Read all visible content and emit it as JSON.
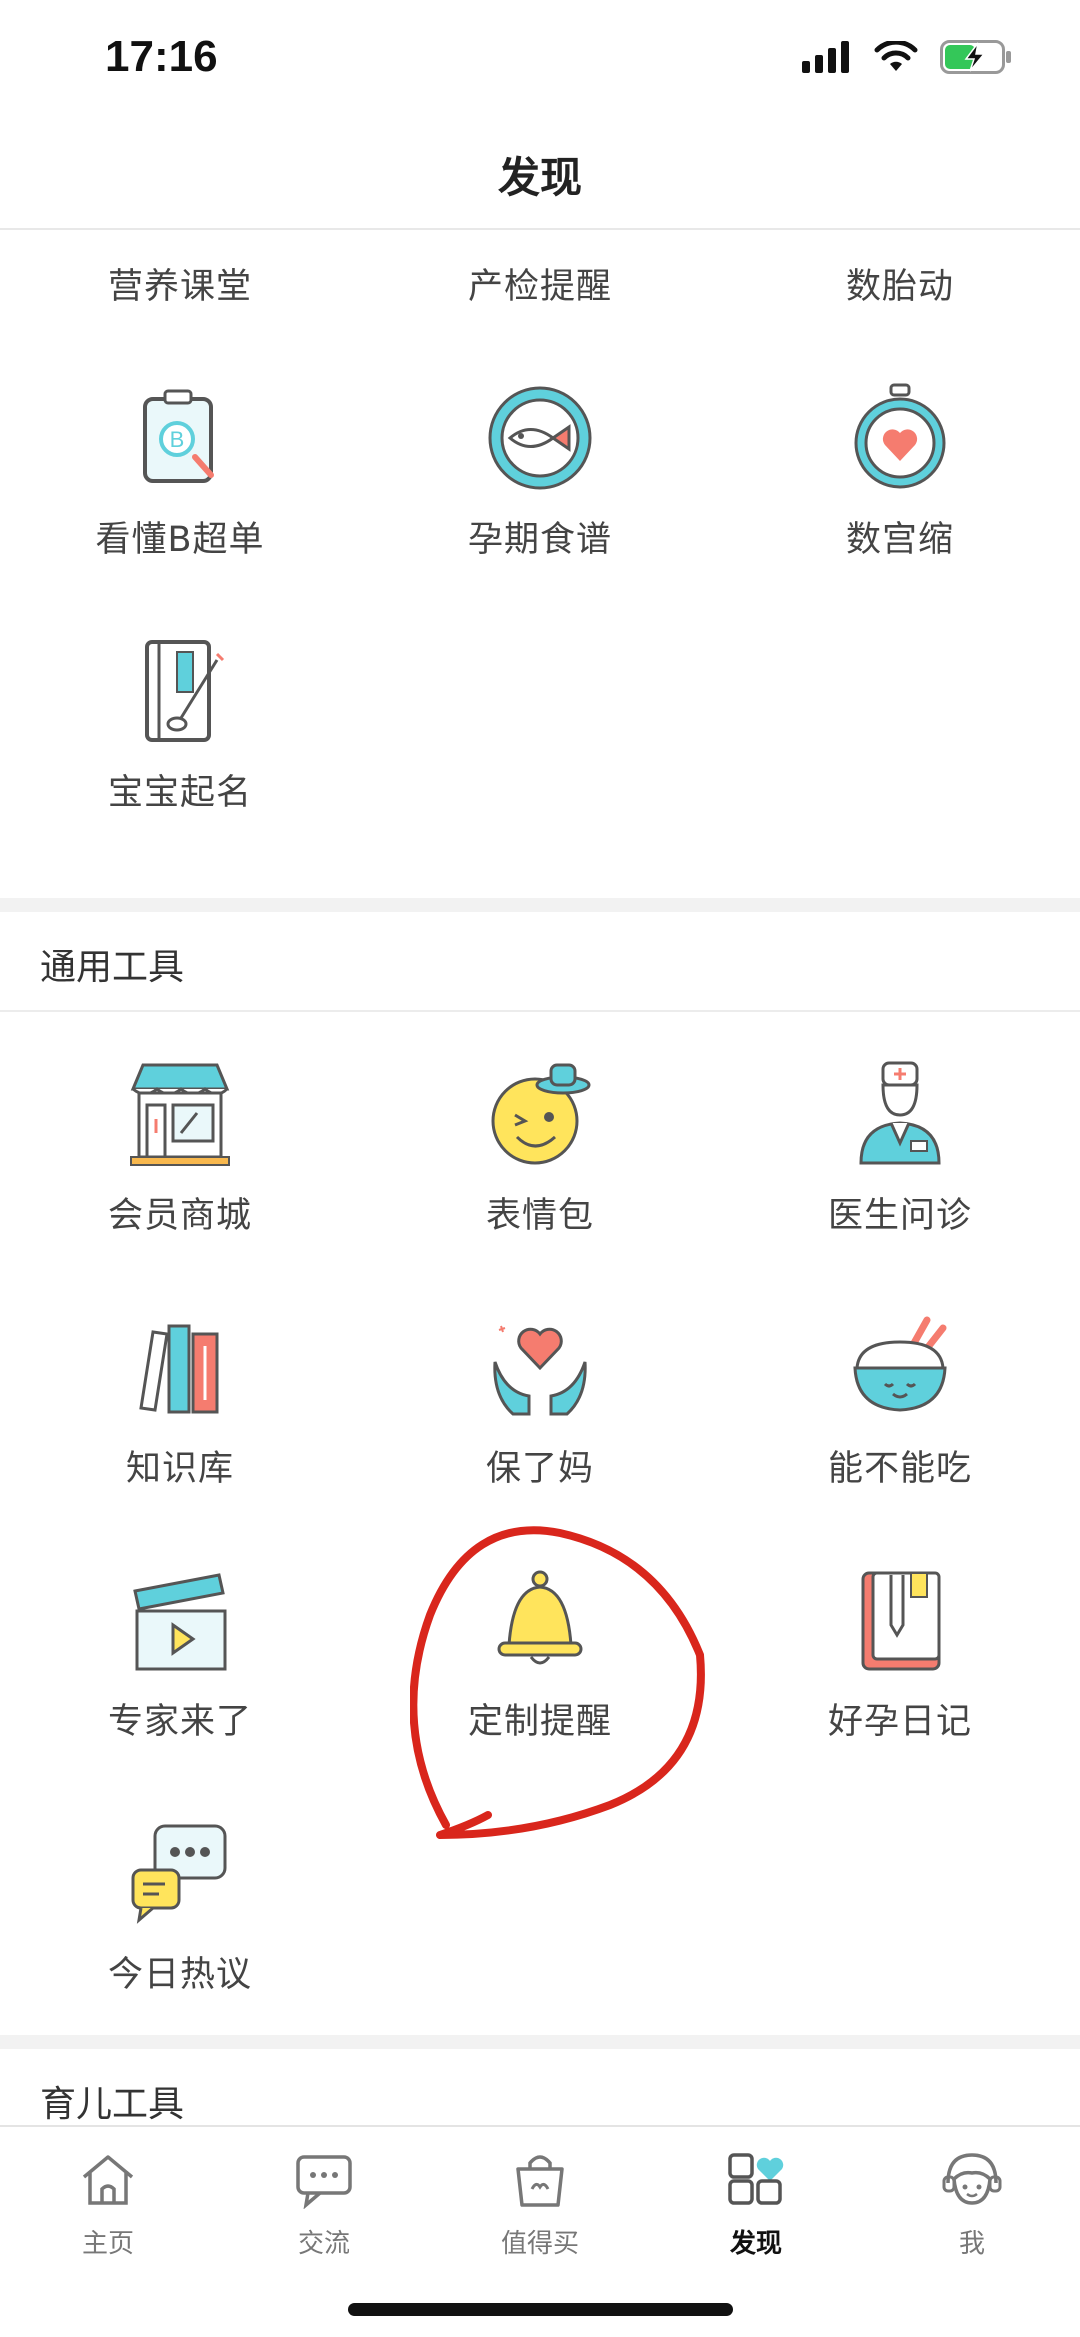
{
  "status_bar": {
    "time": "17:16"
  },
  "header": {
    "title": "发现"
  },
  "top_section": {
    "items": [
      {
        "label": "营养课堂",
        "icon": "nutrition-class-icon"
      },
      {
        "label": "产检提醒",
        "icon": "stethoscope-icon"
      },
      {
        "label": "数胎动",
        "icon": "fetal-movement-icon"
      },
      {
        "label": "看懂B超单",
        "icon": "ultrasound-report-icon"
      },
      {
        "label": "孕期食谱",
        "icon": "fish-plate-icon"
      },
      {
        "label": "数宫缩",
        "icon": "stopwatch-heart-icon"
      },
      {
        "label": "宝宝起名",
        "icon": "name-book-brush-icon"
      }
    ]
  },
  "general_tools": {
    "title": "通用工具",
    "items": [
      {
        "label": "会员商城",
        "icon": "shop-icon"
      },
      {
        "label": "表情包",
        "icon": "emoji-face-icon"
      },
      {
        "label": "医生问诊",
        "icon": "doctor-icon"
      },
      {
        "label": "知识库",
        "icon": "books-icon"
      },
      {
        "label": "保了妈",
        "icon": "hands-heart-icon"
      },
      {
        "label": "能不能吃",
        "icon": "rice-bowl-icon"
      },
      {
        "label": "专家来了",
        "icon": "clapperboard-icon"
      },
      {
        "label": "定制提醒",
        "icon": "bell-icon"
      },
      {
        "label": "好孕日记",
        "icon": "diary-icon"
      },
      {
        "label": "今日热议",
        "icon": "chat-bubbles-icon"
      }
    ]
  },
  "parenting_tools": {
    "title": "育儿工具"
  },
  "tab_bar": {
    "tabs": [
      {
        "label": "主页",
        "icon": "home-icon"
      },
      {
        "label": "交流",
        "icon": "chat-icon"
      },
      {
        "label": "值得买",
        "icon": "shopping-bag-icon"
      },
      {
        "label": "发现",
        "icon": "discover-grid-icon",
        "active": true
      },
      {
        "label": "我",
        "icon": "profile-face-icon"
      }
    ]
  },
  "colors": {
    "accent_cyan": "#5fd0dc",
    "annotation_red": "#d9261c",
    "bell_yellow": "#ffe45c"
  }
}
